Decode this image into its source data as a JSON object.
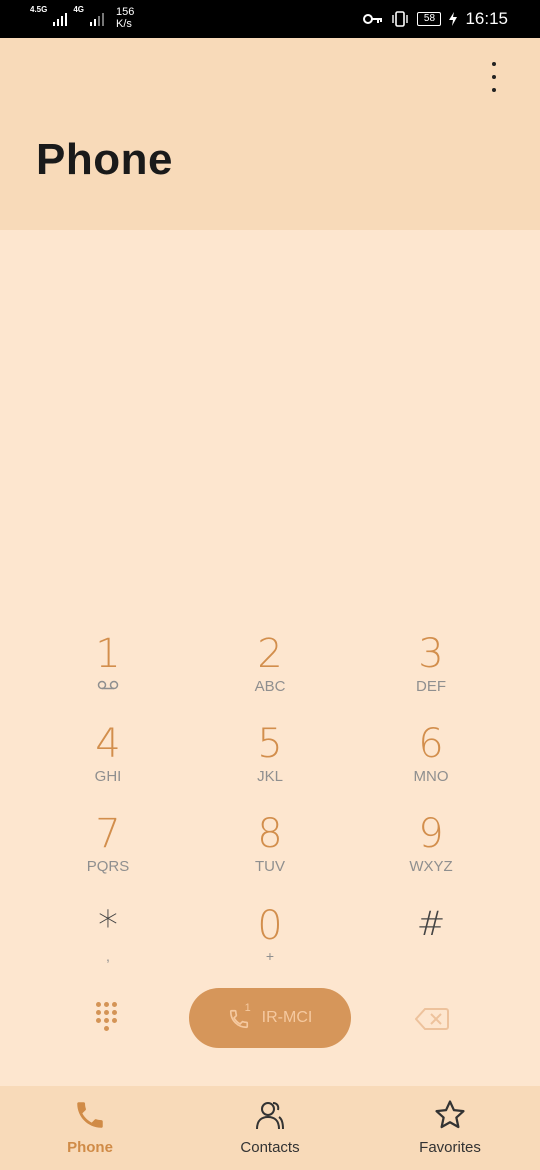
{
  "status_bar": {
    "network_1": "4.5G",
    "network_2": "4G",
    "speed_value": "156",
    "speed_unit": "K/s",
    "battery": "58",
    "time": "16:15"
  },
  "header": {
    "title": "Phone",
    "more_icon": "more-vertical-icon"
  },
  "keypad": {
    "keys": [
      {
        "digit": "1",
        "letters": ""
      },
      {
        "digit": "2",
        "letters": "ABC"
      },
      {
        "digit": "3",
        "letters": "DEF"
      },
      {
        "digit": "4",
        "letters": "GHI"
      },
      {
        "digit": "5",
        "letters": "JKL"
      },
      {
        "digit": "6",
        "letters": "MNO"
      },
      {
        "digit": "7",
        "letters": "PQRS"
      },
      {
        "digit": "8",
        "letters": "TUV"
      },
      {
        "digit": "9",
        "letters": "WXYZ"
      },
      {
        "digit": "*",
        "letters": ","
      },
      {
        "digit": "0",
        "letters": "+"
      },
      {
        "digit": "#",
        "letters": ""
      }
    ]
  },
  "actions": {
    "call_label": "IR-MCI",
    "sim_number": "1"
  },
  "bottom_nav": {
    "items": [
      {
        "label": "Phone",
        "icon": "phone-icon",
        "active": true
      },
      {
        "label": "Contacts",
        "icon": "contacts-icon",
        "active": false
      },
      {
        "label": "Favorites",
        "icon": "star-icon",
        "active": false
      }
    ]
  },
  "colors": {
    "accent": "#d28e4c",
    "background": "#fde6cf",
    "header_bg": "#f8dab9"
  }
}
